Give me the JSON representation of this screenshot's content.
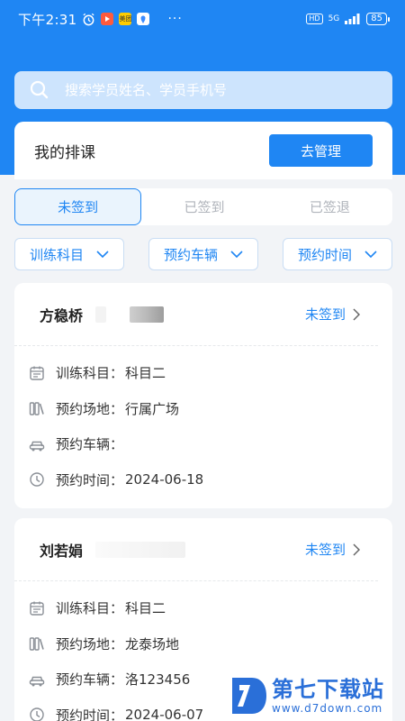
{
  "status_bar": {
    "time": "下午2:31",
    "apps": [
      {
        "icon": "alarm-icon"
      },
      {
        "icon": "video-app-icon",
        "color": "#ff5a3c"
      },
      {
        "icon": "meituan-app-icon",
        "color": "#ffcc00",
        "text": "美团"
      },
      {
        "icon": "map-app-icon",
        "color": "#3a8cff"
      }
    ],
    "more": "···",
    "network": "5G",
    "hd": "HD",
    "battery": "85"
  },
  "search": {
    "placeholder": "搜索学员姓名、学员手机号"
  },
  "schedule": {
    "title": "我的排课",
    "manage_label": "去管理"
  },
  "tabs": [
    {
      "label": "未签到",
      "active": true
    },
    {
      "label": "已签到",
      "active": false
    },
    {
      "label": "已签退",
      "active": false
    }
  ],
  "filters": [
    {
      "label": "训练科目"
    },
    {
      "label": "预约车辆"
    },
    {
      "label": "预约时间"
    }
  ],
  "cards": [
    {
      "name": "方稳桥",
      "status": "未签到",
      "fields": [
        {
          "icon": "calendar-icon",
          "label": "训练科目：",
          "value": "科目二"
        },
        {
          "icon": "venue-icon",
          "label": "预约场地：",
          "value": "行属广场"
        },
        {
          "icon": "car-icon",
          "label": "预约车辆：",
          "value": ""
        },
        {
          "icon": "clock-icon",
          "label": "预约时间：",
          "value": "2024-06-18"
        }
      ]
    },
    {
      "name": "刘若娟",
      "status": "未签到",
      "fields": [
        {
          "icon": "calendar-icon",
          "label": "训练科目：",
          "value": "科目二"
        },
        {
          "icon": "venue-icon",
          "label": "预约场地：",
          "value": "龙泰场地"
        },
        {
          "icon": "car-icon",
          "label": "预约车辆：",
          "value": "洛123456"
        },
        {
          "icon": "clock-icon",
          "label": "预约时间：",
          "value": "2024-06-07"
        }
      ]
    }
  ],
  "watermark": {
    "title": "第七下载站",
    "url": "www.d7down.com"
  },
  "colors": {
    "brand": "#1f86f3",
    "background": "#f2f4f7"
  }
}
